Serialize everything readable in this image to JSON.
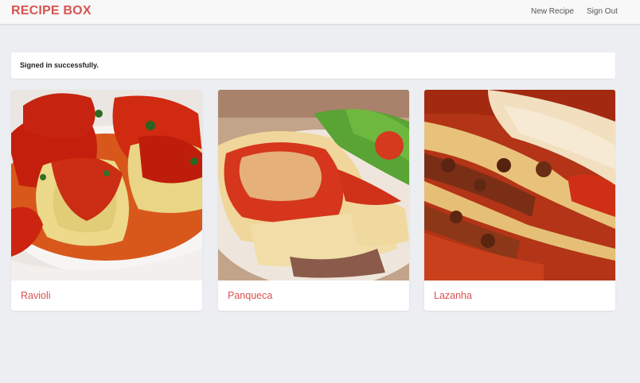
{
  "navbar": {
    "brand": "RECIPE BOX",
    "links": [
      "New Recipe",
      "Sign Out"
    ]
  },
  "flash": {
    "message": "Signed in successfully."
  },
  "recipes": [
    {
      "title": "Ravioli",
      "image": "ravioli-photo"
    },
    {
      "title": "Panqueca",
      "image": "panqueca-photo"
    },
    {
      "title": "Lazanha",
      "image": "lazanha-photo"
    }
  ],
  "colors": {
    "brand": "#d9534f",
    "background": "#eceef2",
    "navbar": "#f8f8f8"
  }
}
